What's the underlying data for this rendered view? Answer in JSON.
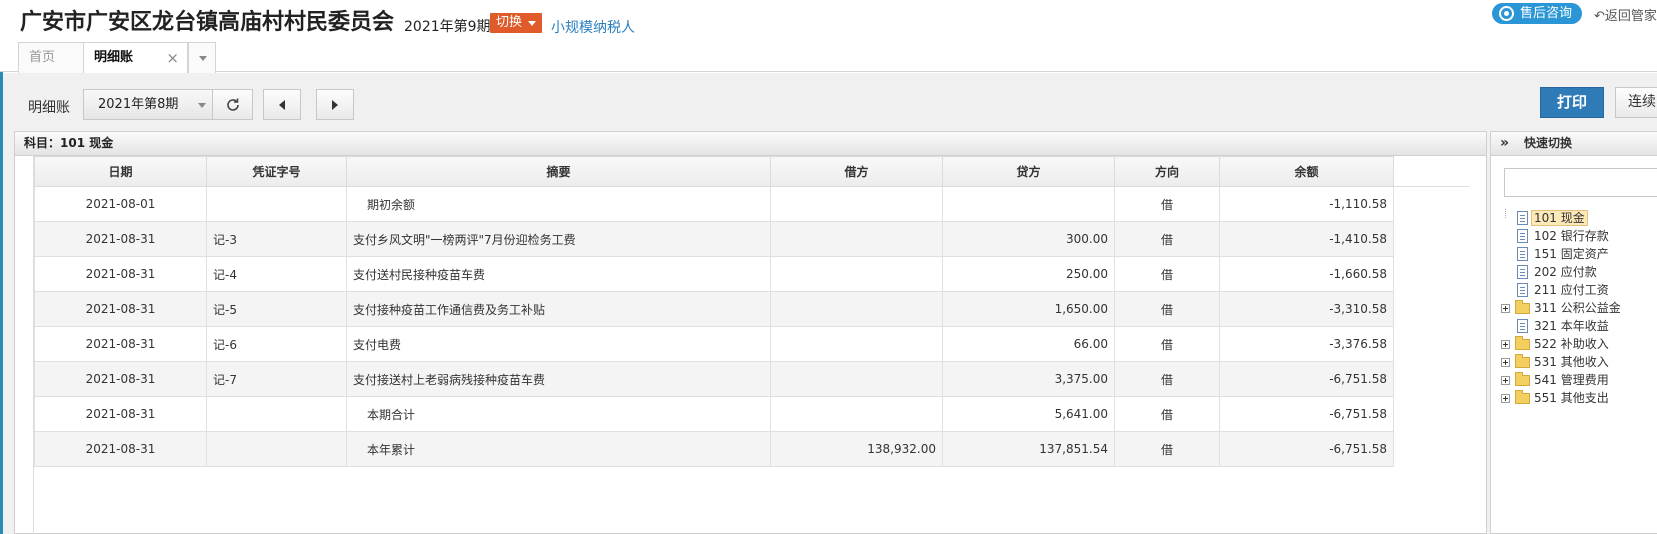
{
  "header": {
    "org_name": "广安市广安区龙台镇高庙村村民委员会",
    "period": "2021年第9期",
    "switch_label": "切换",
    "taxpayer_type": "小规模纳税人",
    "service_label": "售后咨询",
    "back_label": "返回管家"
  },
  "tabs": [
    {
      "label": "首页"
    },
    {
      "label": "明细账"
    }
  ],
  "toolbar": {
    "label": "明细账",
    "period_value": "2021年第8期",
    "print_label": "打印",
    "continuous_label": "连续"
  },
  "ledger": {
    "subject": "科目：101 现金",
    "columns": [
      "日期",
      "凭证字号",
      "摘要",
      "借方",
      "贷方",
      "方向",
      "余额"
    ],
    "rows": [
      {
        "date": "2021-08-01",
        "voucher": "",
        "summary": "期初余额",
        "debit": "",
        "credit": "",
        "direction": "借",
        "balance": "-1,110.58"
      },
      {
        "date": "2021-08-31",
        "voucher": "记-3",
        "summary": "支付乡风文明\"一榜两评\"7月份迎检务工费",
        "debit": "",
        "credit": "300.00",
        "direction": "借",
        "balance": "-1,410.58"
      },
      {
        "date": "2021-08-31",
        "voucher": "记-4",
        "summary": "支付送村民接种疫苗车费",
        "debit": "",
        "credit": "250.00",
        "direction": "借",
        "balance": "-1,660.58"
      },
      {
        "date": "2021-08-31",
        "voucher": "记-5",
        "summary": "支付接种疫苗工作通信费及务工补贴",
        "debit": "",
        "credit": "1,650.00",
        "direction": "借",
        "balance": "-3,310.58"
      },
      {
        "date": "2021-08-31",
        "voucher": "记-6",
        "summary": "支付电费",
        "debit": "",
        "credit": "66.00",
        "direction": "借",
        "balance": "-3,376.58"
      },
      {
        "date": "2021-08-31",
        "voucher": "记-7",
        "summary": "支付接送村上老弱病残接种疫苗车费",
        "debit": "",
        "credit": "3,375.00",
        "direction": "借",
        "balance": "-6,751.58"
      },
      {
        "date": "2021-08-31",
        "voucher": "",
        "summary": "本期合计",
        "debit": "",
        "credit": "5,641.00",
        "direction": "借",
        "balance": "-6,751.58"
      },
      {
        "date": "2021-08-31",
        "voucher": "",
        "summary": "本年累计",
        "debit": "138,932.00",
        "credit": "137,851.54",
        "direction": "借",
        "balance": "-6,751.58"
      }
    ]
  },
  "quick_switch": {
    "title": "快速切换",
    "search_placeholder": "",
    "accounts": [
      {
        "label": "101 现金",
        "type": "doc",
        "selected": true
      },
      {
        "label": "102 银行存款",
        "type": "doc"
      },
      {
        "label": "151 固定资产",
        "type": "doc"
      },
      {
        "label": "202 应付款",
        "type": "doc"
      },
      {
        "label": "211 应付工资",
        "type": "doc"
      },
      {
        "label": "311 公积公益金",
        "type": "folder"
      },
      {
        "label": "321 本年收益",
        "type": "doc"
      },
      {
        "label": "522 补助收入",
        "type": "folder"
      },
      {
        "label": "531 其他收入",
        "type": "folder"
      },
      {
        "label": "541 管理费用",
        "type": "folder"
      },
      {
        "label": "551 其他支出",
        "type": "folder"
      }
    ]
  },
  "colors": {
    "accent": "#2a8ab8",
    "switch_button": "#e05a2a",
    "print_button": "#2f7bb8",
    "service_button": "#2b96d6",
    "selected_node": "#fde9b8"
  }
}
